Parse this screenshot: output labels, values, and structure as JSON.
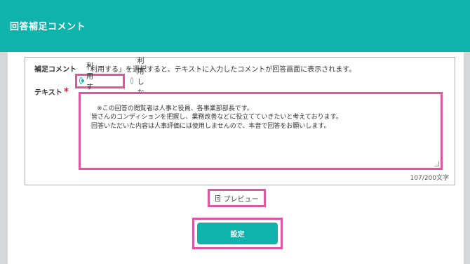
{
  "header": {
    "title": "回答補足コメント"
  },
  "form": {
    "supplement_label": "補足コメント",
    "supplement_description": "「利用する」を選択すると、テキストに入力したコメントが回答画面に表示されます。",
    "radio_options": [
      {
        "label": "利用する",
        "selected": true
      },
      {
        "label": "利用しない",
        "selected": false
      }
    ],
    "text_label": "テキスト",
    "required_mark": "*",
    "text_value": "※この回答の閲覧者は人事と役員、各事業部部長です。\n　皆さんのコンディションを把握し、業務改善などに役立てていきたいと考えております。\n　回答いただいた内容は人事評価には使用しませんので、本音で回答をお願いします。",
    "counter": "107/200文字"
  },
  "actions": {
    "preview_label": "プレビュー",
    "submit_label": "設定"
  },
  "colors": {
    "accent": "#10b3ac",
    "highlight": "#e0559e",
    "required": "#d92a4b"
  },
  "icons": {
    "preview": "document-icon"
  }
}
